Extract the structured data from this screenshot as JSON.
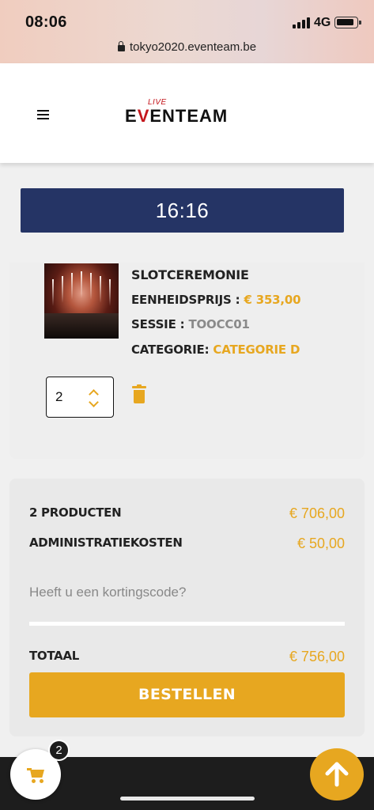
{
  "status_bar": {
    "time": "08:06",
    "network": "4G"
  },
  "browser": {
    "url": "tokyo2020.eventeam.be"
  },
  "header": {
    "logo_top": "LIVE",
    "logo_e": "E",
    "logo_v": "V",
    "logo_rest": "ENTEAM"
  },
  "timer": {
    "value": "16:16"
  },
  "product": {
    "name": "SLOTCEREMONIE",
    "unit_price_label": "EENHEIDSPRIJS :",
    "unit_price": "€ 353,00",
    "session_label": "SESSIE :",
    "session": "TOOCC01",
    "category_label": "CATEGORIE:",
    "category": "CATEGORIE D",
    "quantity": "2"
  },
  "summary": {
    "products_label": "2 PRODUCTEN",
    "products_amount": "€ 706,00",
    "admin_label": "ADMINISTRATIEKOSTEN",
    "admin_amount": "€ 50,00",
    "coupon_placeholder": "Heeft u een kortingscode?",
    "total_label": "TOTAAL",
    "total_amount": "€ 756,00",
    "order_button": "BESTELLEN"
  },
  "footer": {
    "cart_count": "2"
  },
  "icons": {
    "menu": "hamburger-icon",
    "trash": "trash-icon",
    "cart": "cart-icon",
    "scroll_top": "arrow-up-icon",
    "qty_up": "chevron-up-icon",
    "qty_down": "chevron-down-icon"
  },
  "colors": {
    "accent": "#e7a720",
    "timer_bg": "#253465",
    "brand_red": "#c4161c",
    "footer_bg": "#1d1d1d"
  }
}
